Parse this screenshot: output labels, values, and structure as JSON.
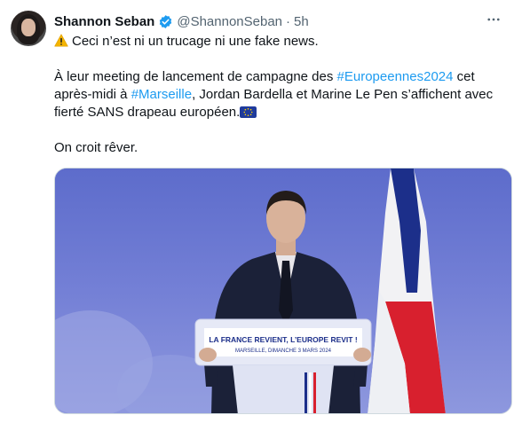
{
  "author": {
    "name": "Shannon Seban",
    "handle": "@ShannonSeban",
    "separator": "·",
    "time": "5h"
  },
  "tweet": {
    "line1": "Ceci n’est ni un trucage ni une fake news.",
    "p2_start": "À leur meeting de lancement de campagne des ",
    "hashtag1": "#Europeennes2024",
    "p2_mid1": " cet après-midi à ",
    "hashtag2": "#Marseille",
    "p2_mid2": ", Jordan Bardella et Marine Le Pen s’affichent avec fierté SANS drapeau européen.",
    "line3": "On croit rêver."
  },
  "media": {
    "podium_title": "LA FRANCE REVIENT, L’EUROPE REVIT !",
    "podium_subtitle": "MARSEILLE, DIMANCHE 3 MARS 2024"
  },
  "icons": {
    "verified": "verified-badge-icon",
    "warning": "warning-emoji",
    "eu_flag": "eu-flag-emoji",
    "more": "more-options-icon"
  },
  "colors": {
    "link": "#1d9bf0",
    "muted": "#536471",
    "text": "#0f1419"
  }
}
